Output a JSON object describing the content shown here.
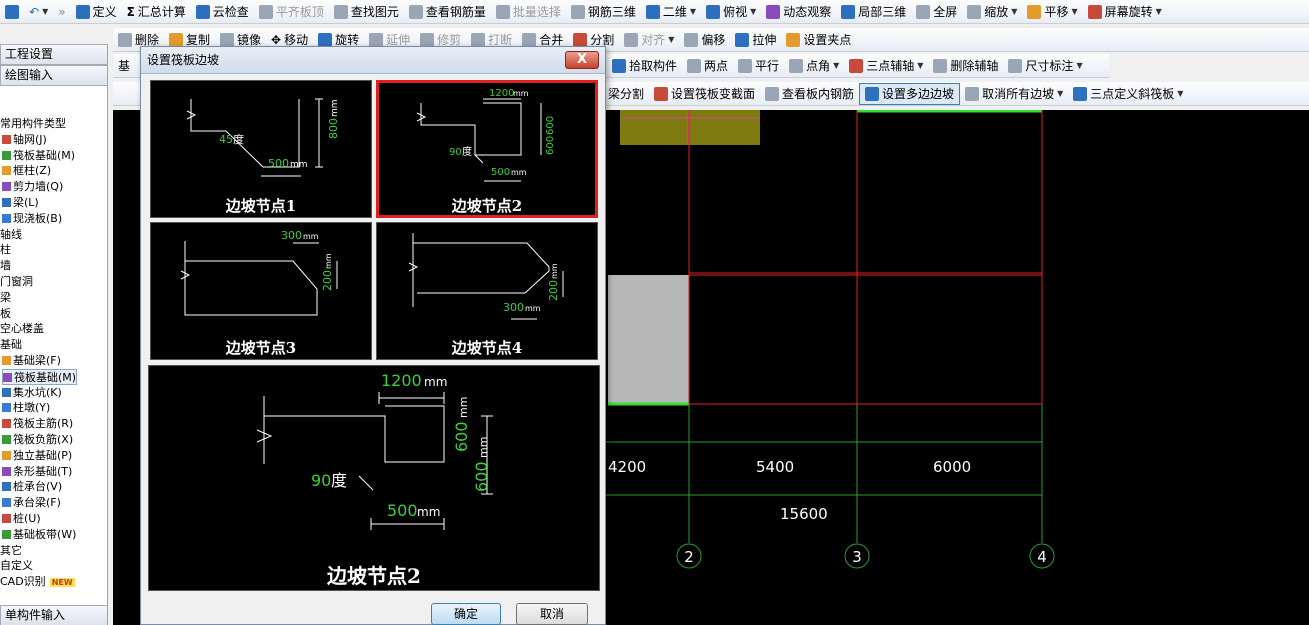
{
  "toolbar1": {
    "items": [
      "定义",
      "汇总计算",
      "云检查",
      "平齐板顶",
      "查找图元",
      "查看钢筋量",
      "批量选择",
      "钢筋三维",
      "二维",
      "俯视",
      "动态观察",
      "局部三维",
      "全屏",
      "缩放",
      "平移",
      "屏幕旋转"
    ]
  },
  "toolbar2": {
    "items": [
      "删除",
      "复制",
      "镜像",
      "移动",
      "旋转",
      "延伸",
      "修剪",
      "打断",
      "合并",
      "分割",
      "对齐",
      "偏移",
      "拉伸",
      "设置夹点"
    ]
  },
  "toolbar3": {
    "prefix": "基",
    "items": [
      "拾取构件",
      "两点",
      "平行",
      "点角",
      "三点辅轴",
      "删除辅轴",
      "尺寸标注"
    ]
  },
  "toolbar4": {
    "items": [
      "梁分割",
      "设置筏板变截面",
      "查看板内钢筋",
      "设置多边边坡",
      "取消所有边坡",
      "三点定义斜筏板"
    ]
  },
  "left_panel": {
    "btn_project": "工程设置",
    "btn_draw": "绘图输入",
    "tree": [
      "常用构件类型",
      "轴网(J)",
      "筏板基础(M)",
      "框柱(Z)",
      "剪力墙(Q)",
      "梁(L)",
      "现浇板(B)",
      "轴线",
      "柱",
      "墙",
      "门窗洞",
      "梁",
      "板",
      "空心楼盖",
      "基础",
      "基础梁(F)",
      "筏板基础(M)",
      "集水坑(K)",
      "柱墩(Y)",
      "筏板主筋(R)",
      "筏板负筋(X)",
      "独立基础(P)",
      "条形基础(T)",
      "桩承台(V)",
      "承台梁(F)",
      "桩(U)",
      "基础板带(W)",
      "其它",
      "自定义",
      "CAD识别",
      "NEW"
    ],
    "bottom": "单构件输入"
  },
  "dialog": {
    "title": "设置筏板边坡",
    "close": "X",
    "nodes": [
      {
        "label": "边坡节点1",
        "angle_num": "45",
        "angle_unit": "度",
        "dim_h": "800",
        "dim_b": "500",
        "unit": "mm"
      },
      {
        "label": "边坡节点2",
        "dim_top": "1200",
        "angle_num": "90",
        "angle_unit": "度",
        "dim_v1": "600",
        "dim_v2": "600",
        "dim_b": "500",
        "unit": "mm"
      },
      {
        "label": "边坡节点3",
        "dim_top": "300",
        "dim_v": "200",
        "unit": "mm"
      },
      {
        "label": "边坡节点4",
        "dim_v": "200",
        "dim_b": "300",
        "unit": "mm"
      }
    ],
    "preview": {
      "label": "边坡节点2",
      "dim_top": "1200",
      "angle_num": "90",
      "angle_unit": "度",
      "dim_v1": "600",
      "dim_v2": "600",
      "dim_b": "500",
      "unit": "mm"
    },
    "ok": "确定",
    "cancel": "取消"
  },
  "canvas": {
    "dims": [
      "4200",
      "5400",
      "6000"
    ],
    "total": "15600",
    "axes": [
      "2",
      "3",
      "4"
    ]
  },
  "colors": {
    "grid_red": "#e02020",
    "grid_green": "#2f9a2f",
    "highlight": "#e0201c",
    "dim_green": "#39d039"
  }
}
